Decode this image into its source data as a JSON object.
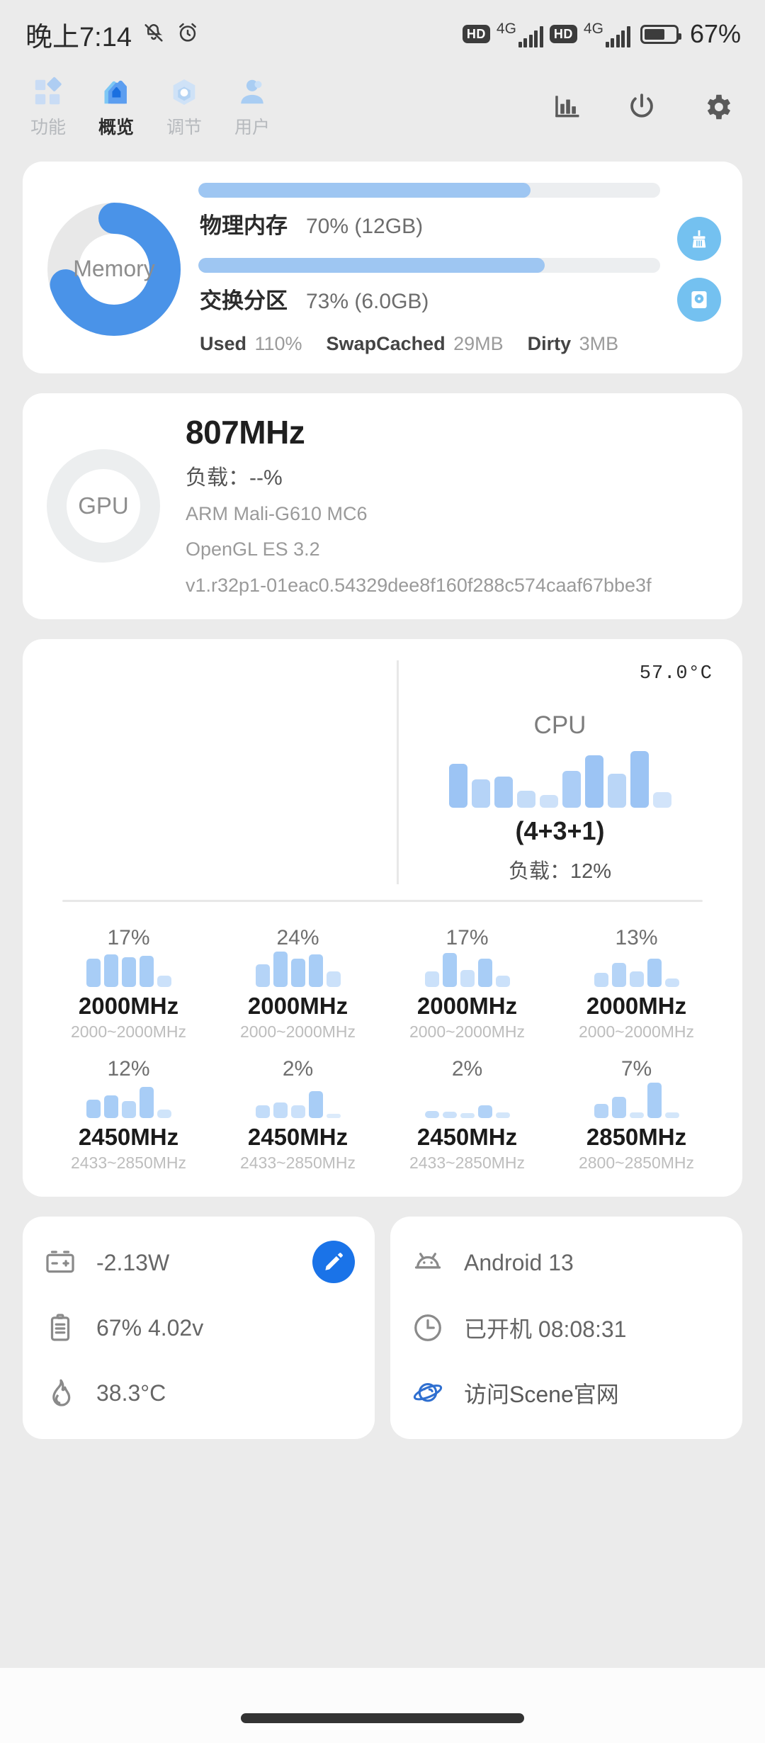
{
  "status_bar": {
    "time": "晚上7:14",
    "icons": [
      "mute-icon",
      "alarm-icon"
    ],
    "sim1_hd": "HD",
    "sim1_net": "4G",
    "sim2_hd": "HD",
    "sim2_net": "4G",
    "battery_percent": "67%",
    "battery_level": 67
  },
  "nav": {
    "tabs": [
      {
        "label": "功能",
        "icon": "grid-diamond-icon",
        "active": false
      },
      {
        "label": "概览",
        "icon": "home-icon",
        "active": true
      },
      {
        "label": "调节",
        "icon": "hexagon-tune-icon",
        "active": false
      },
      {
        "label": "用户",
        "icon": "user-icon",
        "active": false
      }
    ],
    "actions": [
      {
        "name": "chart-icon"
      },
      {
        "name": "power-icon"
      },
      {
        "name": "gear-icon"
      }
    ]
  },
  "memory_card": {
    "ring_label": "Memory",
    "ring_percent": 70,
    "rows": [
      {
        "name": "物理内存",
        "value": "70% (12GB)",
        "percent": 72
      },
      {
        "name": "交换分区",
        "value": "73% (6.0GB)",
        "percent": 75
      }
    ],
    "stats": [
      {
        "key": "Used",
        "value": "110%"
      },
      {
        "key": "SwapCached",
        "value": "29MB"
      },
      {
        "key": "Dirty",
        "value": "3MB"
      }
    ],
    "actions": [
      {
        "name": "broom-clean-icon"
      },
      {
        "name": "disk-swap-icon"
      }
    ]
  },
  "gpu_card": {
    "ring_label": "GPU",
    "frequency": "807MHz",
    "load": "负载：--%",
    "model": "ARM Mali-G610 MC6",
    "api": "OpenGL ES 3.2",
    "driver": "v1.r32p1-01eac0.54329dee8f160f288c574caaf67bbe3f"
  },
  "cpu_card": {
    "temperature": "57.0°C",
    "title": "CPU",
    "config": "(4+3+1)",
    "load": "负载：12%",
    "history_bars": [
      62,
      40,
      44,
      24,
      18,
      52,
      74,
      48,
      80,
      22
    ],
    "history_opacity": [
      1,
      0.75,
      0.9,
      0.6,
      0.5,
      0.85,
      1,
      0.7,
      1,
      0.45
    ],
    "cores": [
      {
        "percent": "17%",
        "freq": "2000MHz",
        "range": "2000~2000MHz",
        "bars": [
          40,
          46,
          42,
          44,
          16
        ],
        "opacity": [
          1,
          1,
          1,
          1,
          0.6
        ]
      },
      {
        "percent": "24%",
        "freq": "2000MHz",
        "range": "2000~2000MHz",
        "bars": [
          32,
          50,
          40,
          46,
          22
        ],
        "opacity": [
          0.85,
          1,
          1,
          1,
          0.6
        ]
      },
      {
        "percent": "17%",
        "freq": "2000MHz",
        "range": "2000~2000MHz",
        "bars": [
          22,
          48,
          24,
          40,
          16
        ],
        "opacity": [
          0.6,
          1,
          0.6,
          1,
          0.6
        ]
      },
      {
        "percent": "13%",
        "freq": "2000MHz",
        "range": "2000~2000MHz",
        "bars": [
          20,
          34,
          22,
          40,
          12
        ],
        "opacity": [
          0.7,
          0.85,
          0.7,
          1,
          0.6
        ]
      },
      {
        "percent": "12%",
        "freq": "2450MHz",
        "range": "2433~2850MHz",
        "bars": [
          26,
          32,
          24,
          44,
          12
        ],
        "opacity": [
          1,
          1,
          0.8,
          1,
          0.55
        ]
      },
      {
        "percent": "2%",
        "freq": "2450MHz",
        "range": "2433~2850MHz",
        "bars": [
          18,
          22,
          18,
          38,
          6
        ],
        "opacity": [
          0.7,
          0.7,
          0.6,
          1,
          0.4
        ]
      },
      {
        "percent": "2%",
        "freq": "2450MHz",
        "range": "2433~2850MHz",
        "bars": [
          10,
          9,
          7,
          18,
          8
        ],
        "opacity": [
          0.7,
          0.6,
          0.5,
          0.9,
          0.5
        ]
      },
      {
        "percent": "7%",
        "freq": "2850MHz",
        "range": "2800~2850MHz",
        "bars": [
          20,
          30,
          8,
          50,
          8
        ],
        "opacity": [
          0.85,
          0.9,
          0.5,
          1,
          0.5
        ]
      }
    ]
  },
  "device_card": {
    "rows": [
      {
        "icon": "battery-terminal-icon",
        "text": "-2.13W"
      },
      {
        "icon": "battery-icon",
        "text": "67%  4.02v"
      },
      {
        "icon": "flame-icon",
        "text": "38.3°C"
      }
    ],
    "edit_button": {
      "name": "edit-pencil-icon"
    }
  },
  "system_card": {
    "rows": [
      {
        "icon": "android-icon",
        "text": "Android 13"
      },
      {
        "icon": "clock-icon",
        "text": "已开机  08:08:31"
      },
      {
        "icon": "planet-icon",
        "text": "访问Scene官网"
      }
    ]
  },
  "colors": {
    "background": "#ebebeb",
    "card": "#ffffff",
    "accent_blue": "#4a93e8",
    "light_blue": "#9cc4f4",
    "action_blue": "#74c1f0",
    "fab_blue": "#1a73e8"
  }
}
